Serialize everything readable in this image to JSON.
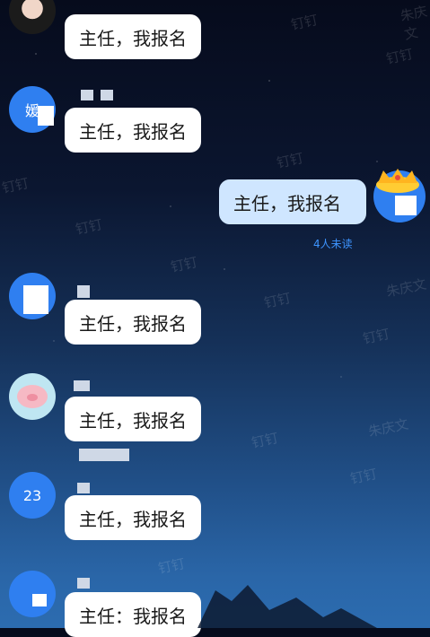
{
  "watermarks": [
    "钉钉",
    "钉钉",
    "钉钉",
    "钉钉",
    "钉钉",
    "钉钉",
    "钉钉",
    "钉钉",
    "钉钉",
    "朱庆文",
    "朱庆文",
    "朱庆文",
    "钉钉",
    "钉钉"
  ],
  "messages": [
    {
      "text": "主任，我报名",
      "avatar_label": ""
    },
    {
      "text": "主任，我报名",
      "avatar_label": "媛"
    },
    {
      "text": "主任，我报名",
      "avatar_label": ""
    },
    {
      "text": "主任，我报名",
      "avatar_label": ""
    },
    {
      "text": "主任，我报名",
      "avatar_label": "23"
    },
    {
      "text": "主任：我报名",
      "avatar_label": ""
    }
  ],
  "sent_message": {
    "text": "主任，我报名",
    "status": "4人未读"
  },
  "colors": {
    "unread": "#3d94ff",
    "sent_bubble": "#cfe6ff",
    "avatar_blue": "#2f7ff0"
  }
}
